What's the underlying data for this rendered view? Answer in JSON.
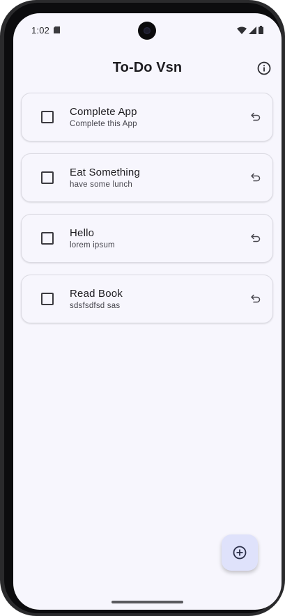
{
  "status_bar": {
    "time": "1:02",
    "icons": [
      "sd-card-icon",
      "wifi-icon",
      "signal-icon",
      "battery-icon"
    ]
  },
  "app_bar": {
    "title": "To-Do Vsn",
    "action_icon": "info-icon"
  },
  "tasks": [
    {
      "title": "Complete App",
      "subtitle": "Complete this App",
      "checked": false,
      "action_icon": "undo-icon"
    },
    {
      "title": "Eat Something",
      "subtitle": "have some lunch",
      "checked": false,
      "action_icon": "undo-icon"
    },
    {
      "title": "Hello",
      "subtitle": "lorem ipsum",
      "checked": false,
      "action_icon": "undo-icon"
    },
    {
      "title": "Read Book",
      "subtitle": "sdsfsdfsd sas",
      "checked": false,
      "action_icon": "undo-icon"
    }
  ],
  "fab": {
    "icon": "add-circle-icon"
  },
  "colors": {
    "background": "#f7f6fd",
    "fab_background": "#dfe2fb",
    "text_primary": "#1c1b1f",
    "text_secondary": "#47464e",
    "card_border": "#dcdbe3"
  }
}
